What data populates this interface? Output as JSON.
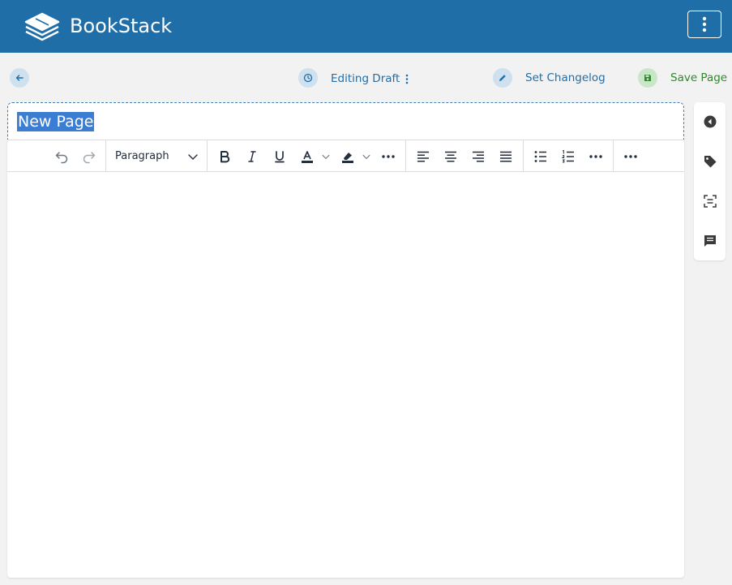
{
  "app": {
    "name": "BookStack"
  },
  "toolbar": {
    "draft_label": "Editing Draft",
    "changelog_label": "Set Changelog",
    "save_label": "Save Page"
  },
  "page": {
    "title": "New Page"
  },
  "editor": {
    "block_format": "Paragraph"
  },
  "colors": {
    "header": "#1f6ea8",
    "accent": "#1f6ea8",
    "save": "#2c8a2c"
  }
}
